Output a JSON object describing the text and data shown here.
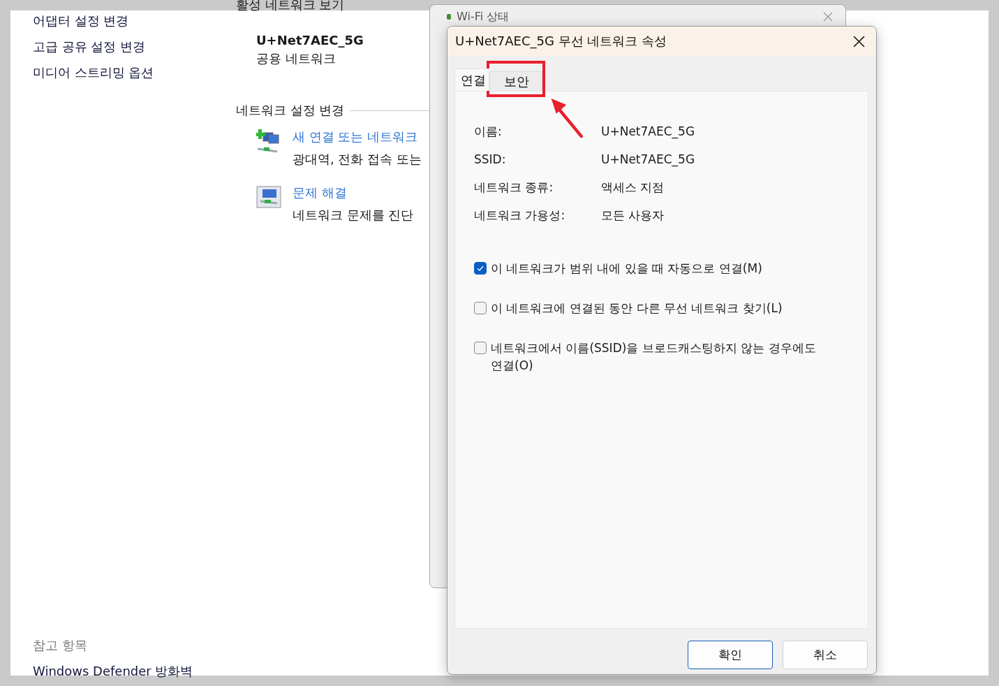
{
  "control_panel": {
    "sidebar_links": [
      "어댑터 설정 변경",
      "고급 공유 설정 변경",
      "미디어 스트리밍 옵션"
    ],
    "active_heading": "활성 네트워크 보기",
    "network": {
      "name": "U+Net7AEC_5G",
      "category": "공용 네트워크"
    },
    "settings_heading": "네트워크 설정 변경",
    "tasks": [
      {
        "kind": "new-connection",
        "link": "새 연결 또는 네트워크",
        "description": "광대역, 전화 접속 또는"
      },
      {
        "kind": "troubleshoot",
        "link": "문제 해결",
        "description": "네트워크 문제를 진단"
      }
    ],
    "see_also": {
      "heading": "참고 항목",
      "links": [
        "Windows Defender 방화벽"
      ]
    }
  },
  "status_window": {
    "title": "Wi-Fi 상태"
  },
  "dialog": {
    "title": "U+Net7AEC_5G 무선 네트워크 속성",
    "tabs": [
      {
        "label": "연결",
        "selected": true
      },
      {
        "label": "보안",
        "selected": false
      }
    ],
    "properties": [
      {
        "label": "이름:",
        "value": "U+Net7AEC_5G"
      },
      {
        "label": "SSID:",
        "value": "U+Net7AEC_5G"
      },
      {
        "label": "네트워크 종류:",
        "value": "액세스 지점"
      },
      {
        "label": "네트워크 가용성:",
        "value": "모든 사용자"
      }
    ],
    "options": [
      {
        "label": "이 네트워크가 범위 내에 있을 때 자동으로 연결(M)",
        "checked": true
      },
      {
        "label": "이 네트워크에 연결된 동안 다른 무선 네트워크 찾기(L)",
        "checked": false
      },
      {
        "label": "네트워크에서 이름(SSID)을 브로드캐스팅하지 않는 경우에도 연결(O)",
        "checked": false
      }
    ],
    "buttons": [
      {
        "label": "확인",
        "kind": "default"
      },
      {
        "label": "취소",
        "kind": "normal"
      }
    ]
  }
}
